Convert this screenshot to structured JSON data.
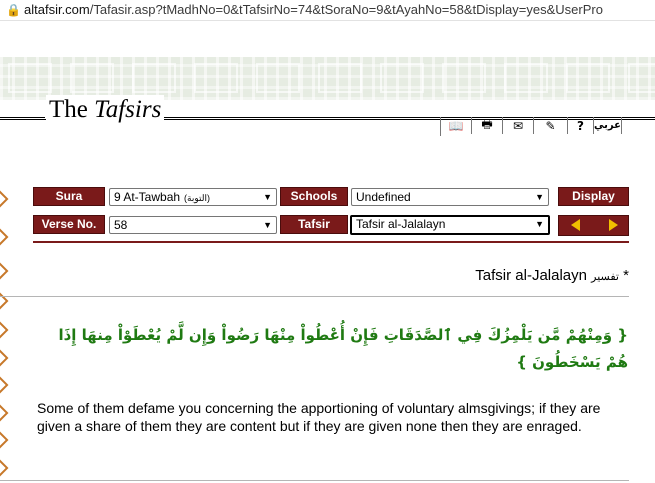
{
  "browser": {
    "url_domain": "altafsir.com",
    "url_path": "/Tafasir.asp?tMadhNo=0&tTafsirNo=74&tSoraNo=9&tAyahNo=58&tDisplay=yes&UserPro"
  },
  "header": {
    "brand_prefix": "The ",
    "brand_italic": "Tafsirs"
  },
  "toolbar": {
    "items": [
      {
        "icon": "book-icon",
        "glyph": "📖"
      },
      {
        "icon": "print-icon",
        "glyph": "🖶"
      },
      {
        "icon": "email-icon",
        "glyph": "✉"
      },
      {
        "icon": "edit-icon",
        "glyph": "✎"
      },
      {
        "icon": "help-icon",
        "glyph": "?"
      },
      {
        "icon": "arabic-language-button",
        "glyph": "عربي"
      }
    ]
  },
  "form": {
    "sura_label": "Sura",
    "sura_value": "9  At-Tawbah",
    "sura_value_arabic": "(التوبة)",
    "schools_label": "Schools",
    "schools_value": "Undefined",
    "display_label": "Display",
    "verse_label": "Verse No.",
    "verse_value": "58",
    "tafsir_label": "Tafsir",
    "tafsir_value": "Tafsir al-Jalalayn",
    "prev_icon": "prev-arrow-icon",
    "next_icon": "next-arrow-icon"
  },
  "content": {
    "tafsir_title": "Tafsir al-Jalalayn",
    "tafsir_title_arabic": "تفسير",
    "tafsir_title_star": "*",
    "verse_arabic": "{ وَمِنْهُمْ مَّن يَلْمِزُكَ فِي ٱلصَّدَقَاتِ فَإِنْ أُعْطُواْ مِنْهَا رَضُواْ وَإِن لَّمْ يُعْطَوْاْ مِنهَا إِذَا هُمْ يَسْخَطُونَ }",
    "translation": "Some of them defame you concerning the apportioning of voluntary almsgivings; if they are given a share of them they are content but if they are given none then they are enraged."
  },
  "colors": {
    "label_bg": "#7a1a1a",
    "verse_text": "#1f7a12",
    "arrow": "#f0c000",
    "marker": "#c7782a"
  }
}
